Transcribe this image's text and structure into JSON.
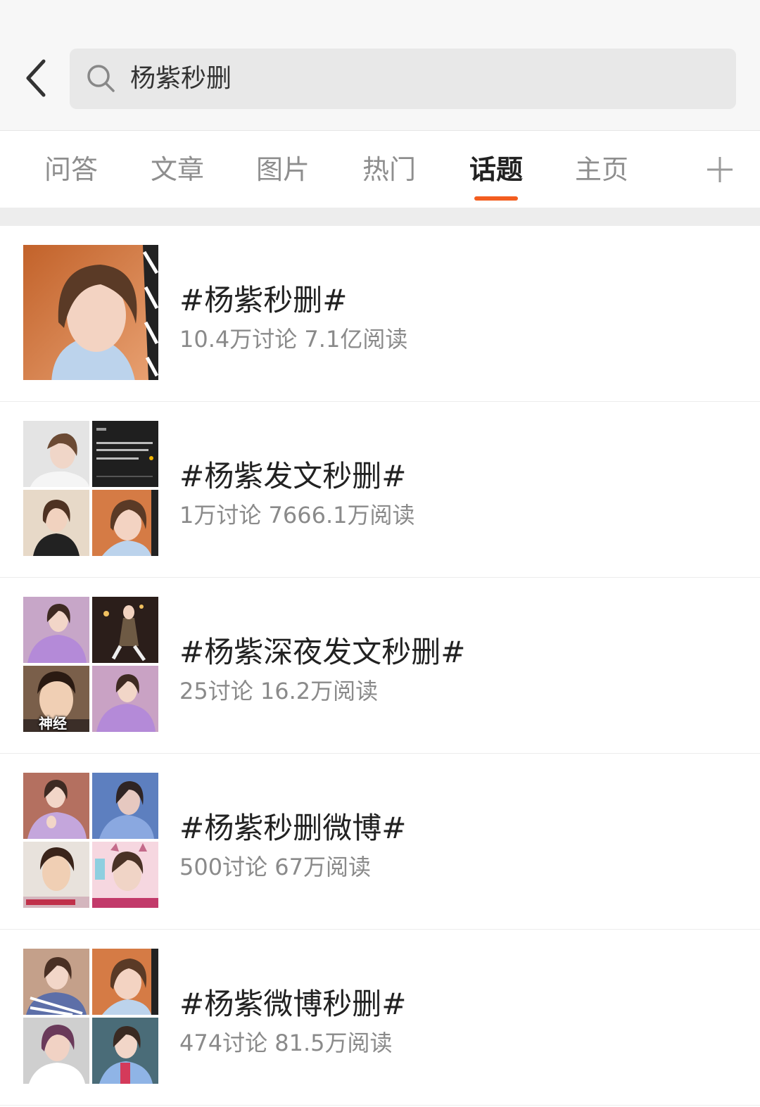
{
  "search": {
    "query": "杨紫秒删"
  },
  "tabs": [
    {
      "label": "问答"
    },
    {
      "label": "文章"
    },
    {
      "label": "图片"
    },
    {
      "label": "热门"
    },
    {
      "label": "话题"
    },
    {
      "label": "主页"
    }
  ],
  "active_tab": "话题",
  "accent_color": "#f35d1f",
  "icons": {
    "back": "chevron-left-icon",
    "search": "search-icon",
    "add": "plus-icon"
  },
  "topics": [
    {
      "title": "#杨紫秒删#",
      "stats": "10.4万讨论 7.1亿阅读",
      "thumb_layout": "single"
    },
    {
      "title": "#杨紫发文秒删#",
      "stats": "1万讨论 7666.1万阅读",
      "thumb_layout": "grid"
    },
    {
      "title": "#杨紫深夜发文秒删#",
      "stats": "25讨论 16.2万阅读",
      "thumb_layout": "grid",
      "thumb_caption": "神经"
    },
    {
      "title": "#杨紫秒删微博#",
      "stats": "500讨论 67万阅读",
      "thumb_layout": "grid"
    },
    {
      "title": "#杨紫微博秒删#",
      "stats": "474讨论 81.5万阅读",
      "thumb_layout": "grid"
    }
  ]
}
